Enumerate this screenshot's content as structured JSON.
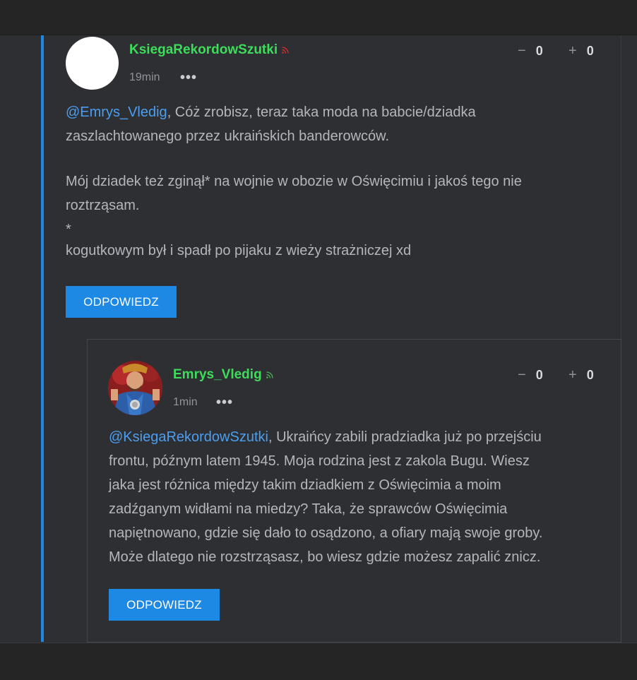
{
  "comments": [
    {
      "username": "KsiegaRekordowSzutki",
      "time": "19min",
      "menu_label": "•••",
      "downvote_symbol": "−",
      "downvotes": "0",
      "upvote_symbol": "+",
      "upvotes": "0",
      "mention": "@Emrys_Vledig",
      "lines": [
        ", Cóż zrobisz, teraz taka moda na babcie/dziadka",
        "zaszlachtowanego przez ukraińskich banderowców.",
        "",
        "Mój dziadek też zginął* na wojnie w obozie w Oświęcimiu i jakoś tego nie",
        "roztrząsam.",
        "*",
        "kogutkowym był i spadł po pijaku z wieży strażniczej xd"
      ],
      "reply_label": "ODPOWIEDZ",
      "rss_color": "#d32f2f"
    },
    {
      "username": "Emrys_Vledig",
      "time": "1min",
      "menu_label": "•••",
      "downvote_symbol": "−",
      "downvotes": "0",
      "upvote_symbol": "+",
      "upvotes": "0",
      "mention": "@KsiegaRekordowSzutki",
      "lines": [
        ", Ukraińcy zabili pradziadka już po przejściu",
        "frontu, późnym latem 1945. Moja rodzina jest z zakola Bugu. Wiesz",
        "jaka jest różnica między takim dziadkiem z Oświęcimia a moim",
        "zadźganym widłami na miedzy? Taka, że sprawców Oświęcimia",
        "napiętnowano, gdzie się dało to osądzono, a ofiary mają swoje groby.",
        "Może dlatego nie rozstrząsasz, bo wiesz gdzie możesz zapalić znicz."
      ],
      "reply_label": "ODPOWIEDZ",
      "rss_color": "#4caf50"
    }
  ],
  "colors": {
    "accent": "#1e88e5",
    "username": "#3ddc5a",
    "mention": "#4b9ef0",
    "background": "#2e2f33"
  },
  "icons": {
    "rss": "rss-feed-icon",
    "avatar": "user-avatar"
  }
}
